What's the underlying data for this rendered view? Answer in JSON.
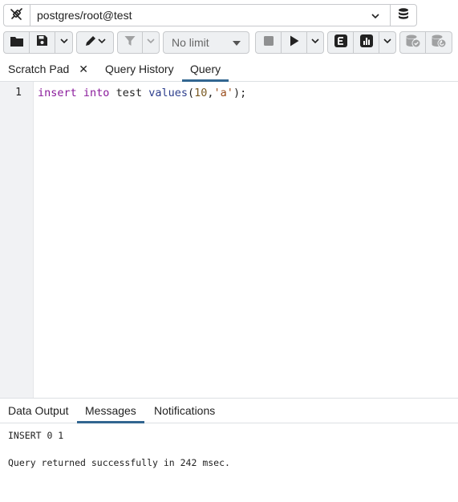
{
  "connection": {
    "value": "postgres/root@test",
    "left_icon": "connection-plug-icon",
    "right_icon": "database-stack-icon"
  },
  "toolbar": {
    "open_icon": "folder-icon",
    "save_icon": "save-icon",
    "edit_icon": "pencil-icon",
    "filter_icon": "filter-icon",
    "limit_value": "No limit",
    "stop_icon": "stop-icon",
    "execute_icon": "play-icon",
    "explain_icon": "explain-icon",
    "explain_analyze_icon": "bar-chart-icon",
    "commit_icon": "commit-icon",
    "rollback_icon": "rollback-icon"
  },
  "tabs": [
    {
      "label": "Scratch Pad",
      "closable": true,
      "close_glyph": "✕"
    },
    {
      "label": "Query History"
    },
    {
      "label": "Query",
      "active": true
    }
  ],
  "editor": {
    "line_number": "1",
    "tokens": [
      {
        "text": "insert",
        "type": "kw"
      },
      {
        "text": " ",
        "type": "plain"
      },
      {
        "text": "into",
        "type": "kw"
      },
      {
        "text": " test ",
        "type": "plain"
      },
      {
        "text": "values",
        "type": "fn"
      },
      {
        "text": "(",
        "type": "plain"
      },
      {
        "text": "10",
        "type": "num"
      },
      {
        "text": ",",
        "type": "plain"
      },
      {
        "text": "'a'",
        "type": "str"
      },
      {
        "text": ");",
        "type": "plain"
      }
    ]
  },
  "output": {
    "tabs": [
      {
        "label": "Data Output"
      },
      {
        "label": "Messages",
        "active": true
      },
      {
        "label": "Notifications"
      }
    ],
    "messages": [
      "INSERT 0 1",
      "",
      "Query returned successfully in 242 msec."
    ]
  },
  "colors": {
    "accent": "#326690",
    "keyword": "#8a1a9b",
    "function": "#2b3d8c"
  }
}
